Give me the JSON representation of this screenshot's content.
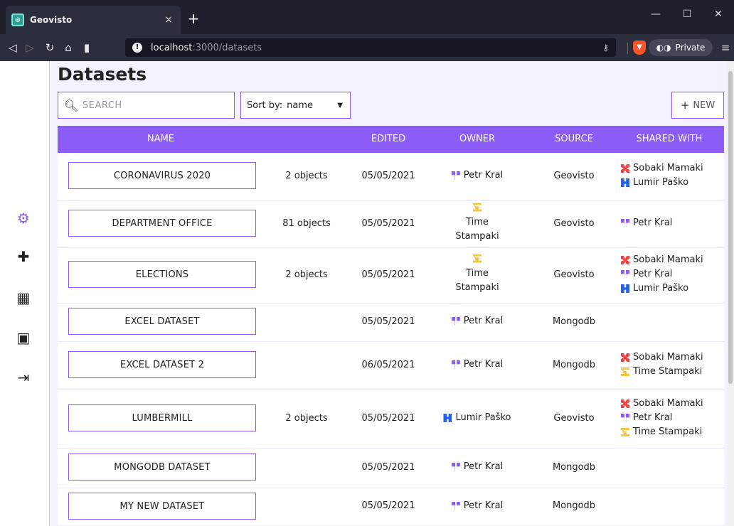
{
  "browser": {
    "tab_title": "Geovisto",
    "tab_close": "×",
    "new_tab": "+",
    "url_host": "localhost",
    "url_path": ":3000/datasets",
    "private_label": "Private",
    "window_controls": [
      "—",
      "☐",
      "✕"
    ]
  },
  "sidebar": {
    "icons": [
      "geovisto-logo-icon",
      "puzzle-icon",
      "presentation-icon",
      "id-card-icon",
      "logout-icon"
    ]
  },
  "page": {
    "title": "Datasets",
    "search_placeholder": "SEARCH",
    "sort_label": "Sort by:",
    "sort_value": "name",
    "new_label": "NEW"
  },
  "table": {
    "headers": [
      "NAME",
      "EDITED",
      "OWNER",
      "SOURCE",
      "SHARED WITH"
    ],
    "rows": [
      {
        "name": "CORONAVIRUS 2020",
        "objects": "2 objects",
        "edited": "05/05/2021",
        "owner": "Petr Kral",
        "source": "Geovisto",
        "shared": [
          "Sobaki Mamaki",
          "Lumir Paško"
        ]
      },
      {
        "name": "DEPARTMENT OFFICE",
        "objects": "81 objects",
        "edited": "05/05/2021",
        "owner": "Time Stampaki",
        "source": "Geovisto",
        "shared": [
          "Petr Kral"
        ]
      },
      {
        "name": "ELECTIONS",
        "objects": "2 objects",
        "edited": "05/05/2021",
        "owner": "Time Stampaki",
        "source": "Geovisto",
        "shared": [
          "Sobaki Mamaki",
          "Petr Kral",
          "Lumir Paško"
        ]
      },
      {
        "name": "EXCEL DATASET",
        "objects": "",
        "edited": "05/05/2021",
        "owner": "Petr Kral",
        "source": "Mongodb",
        "shared": []
      },
      {
        "name": "EXCEL DATASET 2",
        "objects": "",
        "edited": "06/05/2021",
        "owner": "Petr Kral",
        "source": "Mongodb",
        "shared": [
          "Sobaki Mamaki",
          "Time Stampaki"
        ]
      },
      {
        "name": "LUMBERMILL",
        "objects": "2 objects",
        "edited": "05/05/2021",
        "owner": "Lumir Paško",
        "source": "Geovisto",
        "shared": [
          "Sobaki Mamaki",
          "Petr Kral",
          "Time Stampaki"
        ]
      },
      {
        "name": "MONGODB DATASET",
        "objects": "",
        "edited": "05/05/2021",
        "owner": "Petr Kral",
        "source": "Mongodb",
        "shared": []
      },
      {
        "name": "MY NEW DATASET",
        "objects": "",
        "edited": "05/05/2021",
        "owner": "Petr Kral",
        "source": "Mongodb",
        "shared": []
      }
    ]
  },
  "colors": {
    "accent": "#8b5cf6",
    "background": "#f4f2ff",
    "avatar_petr": "#8b5cf6",
    "avatar_lumir": "#2563eb",
    "avatar_sobaki": "#ef4444",
    "avatar_time": "#f4c542"
  }
}
